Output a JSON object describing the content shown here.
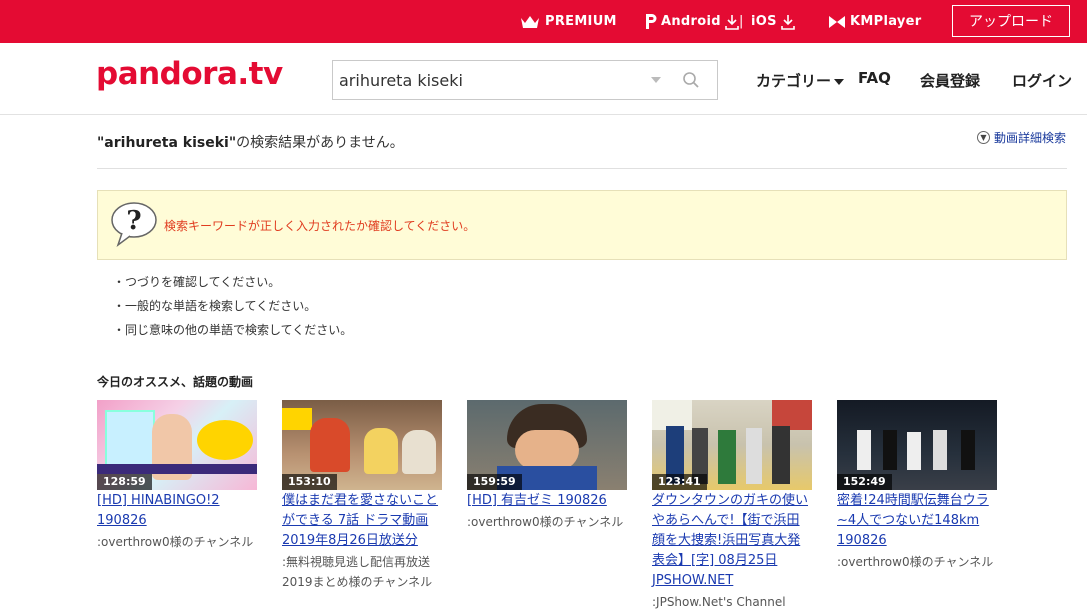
{
  "topbar": {
    "premium": "PREMIUM",
    "android": "Android",
    "separator": "|",
    "ios": "iOS",
    "kmplayer": "KMPlayer",
    "upload": "アップロード"
  },
  "header": {
    "logo": "pandora.tv",
    "search_value": "arihureta kiseki",
    "nav_category": "カテゴリー",
    "nav_faq": "FAQ",
    "nav_register": "会員登録",
    "nav_login": "ログイン"
  },
  "result": {
    "query": "\"arihureta kiseki\"",
    "suffix": "の検索結果がありません。",
    "advanced": "動画詳細検索"
  },
  "notice": {
    "message": "検索キーワードが正しく入力されたか確認してください。"
  },
  "tips": [
    "・つづりを確認してください。",
    "・一般的な単語を検索してください。",
    "・同じ意味の他の単語で検索してください。"
  ],
  "recommend": {
    "heading": "今日のオススメ、話題の動画",
    "items": [
      {
        "duration": "128:59",
        "title_lines": [
          "[HD] HINABINGO!2",
          "190826"
        ],
        "channel_lines": [
          ":overthrow0様のチャンネル"
        ]
      },
      {
        "duration": "153:10",
        "title_lines": [
          "僕はまだ君を愛さないこと",
          "ができる 7話 ドラマ動画",
          "2019年8月26日放送分"
        ],
        "channel_lines": [
          ":無料視聴見逃し配信再放送",
          "2019まとめ様のチャンネル"
        ]
      },
      {
        "duration": "159:59",
        "title_lines": [
          "[HD] 有吉ゼミ 190826"
        ],
        "channel_lines": [
          ":overthrow0様のチャンネル"
        ]
      },
      {
        "duration": "123:41",
        "title_lines": [
          "ダウンタウンのガキの使い",
          "やあらへんで!【街で浜田",
          "顔を大捜索!浜田写真大発",
          "表会】[字] 08月25日",
          "JPSHOW.NET"
        ],
        "channel_lines": [
          ":JPShow.Net's Channel"
        ]
      },
      {
        "duration": "152:49",
        "title_lines": [
          "密着!24時間駅伝舞台ウラ",
          "~4人でつないだ148km",
          "190826"
        ],
        "channel_lines": [
          ":overthrow0様のチャンネル"
        ]
      }
    ]
  },
  "colors": {
    "brand_red": "#e40b33",
    "link_blue": "#1a3ab0",
    "notice_bg": "#fffcd7",
    "notice_text": "#e03c1f"
  }
}
